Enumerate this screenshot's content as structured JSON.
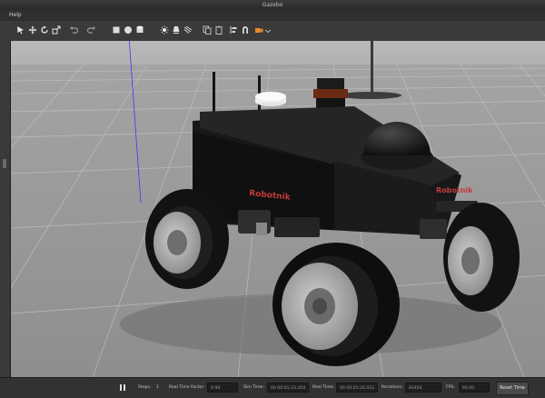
{
  "window": {
    "title": "Gazebo"
  },
  "menu": {
    "items": [
      "Help"
    ]
  },
  "toolbar": {
    "tools": [
      "select-tool",
      "translate-tool",
      "rotate-tool",
      "scale-tool",
      "undo",
      "redo",
      "box-shape",
      "sphere-shape",
      "cylinder-shape",
      "point-light",
      "spot-light",
      "directional-light",
      "copy",
      "paste",
      "align",
      "snap",
      "change-view",
      "screenshot",
      "record"
    ]
  },
  "scene": {
    "brand_front": "Robotnik",
    "brand_side": "Robotnik"
  },
  "status": {
    "steps_label": "Steps:",
    "steps_value": "1",
    "rtf_label": "Real Time Factor:",
    "rtf_value": "0.99",
    "sim_time_label": "Sim Time:",
    "sim_time_value": "00 00:01:23.454",
    "real_time_label": "Real Time:",
    "real_time_value": "00 00:01:24.012",
    "iterations_label": "Iterations:",
    "iterations_value": "83454",
    "fps_label": "FPS:",
    "fps_value": "60.00",
    "reset_label": "Reset Time"
  },
  "colors": {
    "ground": "#9c9c9c",
    "sky": "#b7b7b7",
    "chassis": "#151515",
    "accent": "#c43a3a"
  }
}
